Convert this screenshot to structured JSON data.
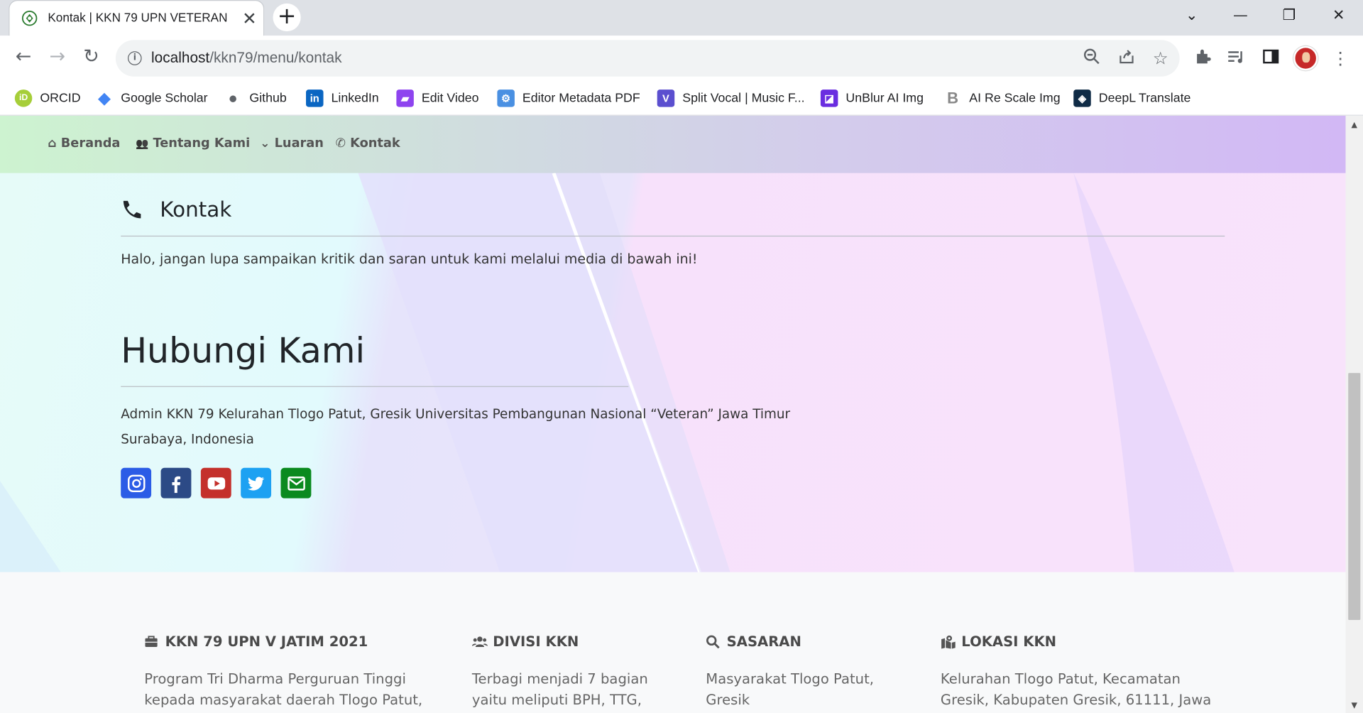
{
  "browser": {
    "tab_title": "Kontak | KKN 79 UPN VETERAN",
    "tab_close": "✕",
    "new_tab": "+",
    "url_host": "localhost",
    "url_path": "/kkn79/menu/kontak",
    "bookmarks": [
      {
        "label": "ORCID",
        "icon": "orcid-icon",
        "color": "#a6ce39"
      },
      {
        "label": "Google Scholar",
        "icon": "google-scholar-icon",
        "color": "#4285f4"
      },
      {
        "label": "Github",
        "icon": "github-icon",
        "color": "#5f6368"
      },
      {
        "label": "LinkedIn",
        "icon": "linkedin-icon",
        "color": "#0a66c2"
      },
      {
        "label": "Edit Video",
        "icon": "edit-video-icon",
        "color": "#8e44ef"
      },
      {
        "label": "Editor Metadata PDF",
        "icon": "pdf-metadata-icon",
        "color": "#4a90e2"
      },
      {
        "label": "Split Vocal | Music F...",
        "icon": "split-vocal-icon",
        "color": "#5b4fcf"
      },
      {
        "label": "UnBlur AI Img",
        "icon": "unblur-icon",
        "color": "#6a2de0"
      },
      {
        "label": "AI Re Scale Img",
        "icon": "rescale-icon",
        "color": "#888888"
      },
      {
        "label": "DeepL Translate",
        "icon": "deepl-icon",
        "color": "#0f2b46"
      }
    ]
  },
  "nav": {
    "items": [
      {
        "label": "Beranda",
        "icon": "home-icon"
      },
      {
        "label": "Tentang Kami",
        "icon": "users-icon"
      },
      {
        "label": "Luaran",
        "icon": "chevron-down-icon"
      },
      {
        "label": "Kontak",
        "icon": "phone-icon"
      }
    ]
  },
  "contact": {
    "section_title": "Kontak",
    "intro": "Halo, jangan lupa sampaikan kritik dan saran untuk kami melalui media di bawah ini!",
    "heading": "Hubungi Kami",
    "address_line1": "Admin KKN 79 Kelurahan Tlogo Patut, Gresik Universitas Pembangunan Nasional “Veteran” Jawa Timur",
    "address_line2": "Surabaya, Indonesia",
    "socials": [
      {
        "icon": "instagram-icon",
        "color": "#2b5ce6"
      },
      {
        "icon": "facebook-icon",
        "color": "#2c4a86"
      },
      {
        "icon": "youtube-icon",
        "color": "#c4302b"
      },
      {
        "icon": "twitter-icon",
        "color": "#1da1f2"
      },
      {
        "icon": "email-icon",
        "color": "#0b8a1f"
      }
    ]
  },
  "footer": {
    "columns": [
      {
        "title": "KKN 79 UPN V JATIM 2021",
        "icon": "briefcase-icon",
        "text": [
          "Program Tri Dharma Perguruan Tinggi",
          "kepada masyarakat daerah Tlogo Patut,"
        ]
      },
      {
        "title": "DIVISI KKN",
        "icon": "users-icon",
        "text": [
          "Terbagi menjadi 7 bagian",
          "yaitu meliputi BPH, TTG,"
        ]
      },
      {
        "title": "SASARAN",
        "icon": "search-icon",
        "text": [
          "Masyarakat Tlogo Patut,",
          "Gresik"
        ]
      },
      {
        "title": "LOKASI KKN",
        "icon": "map-marked-icon",
        "text": [
          "Kelurahan Tlogo Patut, Kecamatan",
          "Gresik, Kabupaten Gresik, 61111, Jawa"
        ]
      }
    ]
  }
}
